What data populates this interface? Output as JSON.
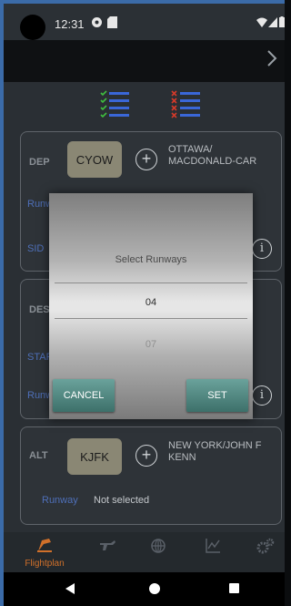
{
  "status": {
    "time": "12:31",
    "icons": [
      "settings-icon",
      "sd-card-icon",
      "wifi-icon",
      "signal-icon",
      "battery-icon"
    ]
  },
  "header": {
    "next_icon": "chevron-right-icon"
  },
  "planner": {
    "icons": [
      "checklist-complete-icon",
      "checklist-incomplete-icon"
    ],
    "colors": {
      "check": "#3fbf3f",
      "cross": "#d43a2a",
      "rows": "#3a67d8"
    }
  },
  "dep": {
    "label": "DEP",
    "code": "CYOW",
    "name": "OTTAWA/ MACDONALD-CAR",
    "runway_label": "Runw",
    "sid_label": "SID"
  },
  "dest": {
    "label": "DEST",
    "star_label": "STAR",
    "runway_label": "Runw"
  },
  "alt": {
    "label": "ALT",
    "code": "KJFK",
    "name": "NEW YORK/JOHN F KENN",
    "runway_label": "Runway",
    "runway_value": "Not selected"
  },
  "dialog": {
    "title": "Select Runways",
    "selected": "04",
    "next": "07",
    "cancel_label": "CANCEL",
    "set_label": "SET"
  },
  "tabs": [
    {
      "label": "Flightplan",
      "icon": "flightplan-icon",
      "active": true
    },
    {
      "label": "",
      "icon": "airplane-icon",
      "active": false
    },
    {
      "label": "",
      "icon": "globe-icon",
      "active": false
    },
    {
      "label": "",
      "icon": "chart-icon",
      "active": false
    },
    {
      "label": "",
      "icon": "settings-gears-icon",
      "active": false
    }
  ],
  "colors": {
    "accent": "#3b6ba8",
    "tab_active": "#d0702a",
    "dialog_button": "#4f8a83"
  }
}
